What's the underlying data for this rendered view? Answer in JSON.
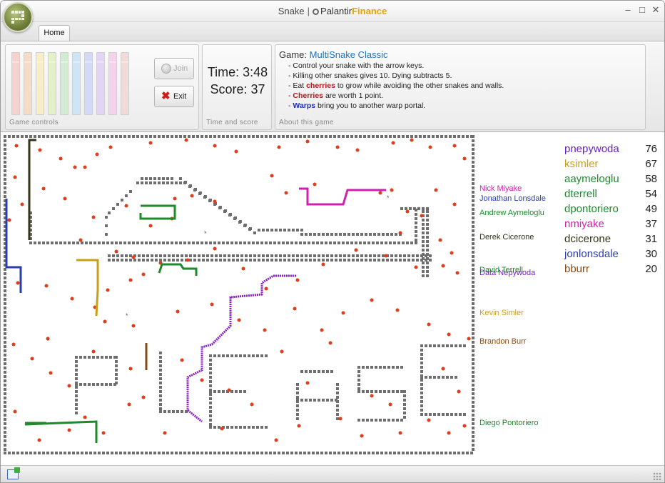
{
  "window": {
    "title_app": "Snake",
    "title_separator": "|",
    "title_brand_a": "Palantir",
    "title_brand_b": "Finance",
    "minimize_glyph": "–",
    "maximize_glyph": "□",
    "close_glyph": "✕"
  },
  "tabs": [
    {
      "label": "Home"
    }
  ],
  "ribbon": {
    "game_controls": {
      "label": "Game controls",
      "bar_colors": [
        "#f6d2cf",
        "#f6dcc8",
        "#f7edc6",
        "#e4f0c8",
        "#d2ecd2",
        "#cfe4f5",
        "#d3d9f7",
        "#e1d4f5",
        "#f4d2ec",
        "#f0dada"
      ],
      "join_label": "Join",
      "exit_label": "Exit"
    },
    "time_score": {
      "label": "Time and score",
      "time_text": "Time: 3:48",
      "score_text": "Score: 37"
    },
    "about": {
      "label": "About this game",
      "game_prefix": "Game:",
      "game_name": "MultiSnake Classic",
      "line1": "- Control your snake with the arrow keys.",
      "line2": "- Killing other snakes gives 10. Dying subtracts 5.",
      "line3_a": "- Eat ",
      "line3_b": "cherries",
      "line3_c": " to grow while avoiding the other snakes and walls.",
      "line4_a": "- ",
      "line4_b": "Cherries",
      "line4_c": " are worth 1 point.",
      "line5_a": "- ",
      "line5_b": "Warps",
      "line5_c": " bring you to another warp portal."
    }
  },
  "board": {
    "wall_color": "#6e6e6e",
    "cherry_color": "#e23c1a",
    "player_labels": [
      {
        "name": "Nick Miyake",
        "color": "#d11fb0"
      },
      {
        "name": "Jonathan Lonsdale",
        "color": "#2a3db0"
      },
      {
        "name": "Andrew Aymeloglu",
        "color": "#1f8a2a"
      },
      {
        "name": "Derek Cicerone",
        "color": "#33331a"
      },
      {
        "name": "David Terrell",
        "color": "#1f8a2a"
      },
      {
        "name": "Data Nepywoda",
        "color": "#7a1fc4"
      },
      {
        "name": "Kevin Simler",
        "color": "#c9a014"
      },
      {
        "name": "Brandon Burr",
        "color": "#8a4a14"
      },
      {
        "name": "Diego Pontoriero",
        "color": "#1f8a2a"
      }
    ]
  },
  "scoreboard": [
    {
      "name": "pnepywoda",
      "score": "76",
      "color": "#6a1fc4"
    },
    {
      "name": "ksimler",
      "score": "67",
      "color": "#c9a014"
    },
    {
      "name": "aaymeloglu",
      "score": "58",
      "color": "#1f8a2a"
    },
    {
      "name": "dterrell",
      "score": "54",
      "color": "#1f8a2a"
    },
    {
      "name": "dpontoriero",
      "score": "49",
      "color": "#1f8a2a"
    },
    {
      "name": "nmiyake",
      "score": "37",
      "color": "#d11fb0"
    },
    {
      "name": "dcicerone",
      "score": "31",
      "color": "#33331a"
    },
    {
      "name": "jonlonsdale",
      "score": "30",
      "color": "#2a3db0"
    },
    {
      "name": "bburr",
      "score": "20",
      "color": "#8a4a14"
    }
  ]
}
